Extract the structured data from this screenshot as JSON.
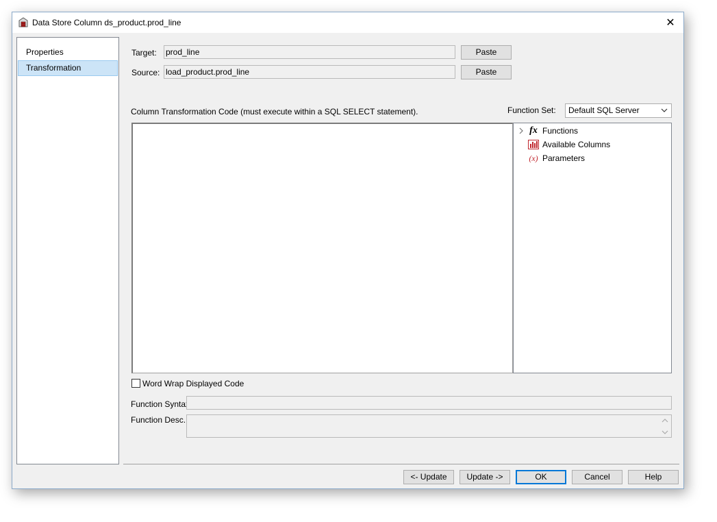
{
  "window": {
    "title": "Data Store Column ds_product.prod_line",
    "close_glyph": "✕"
  },
  "nav": {
    "items": [
      {
        "label": "Properties",
        "selected": false
      },
      {
        "label": "Transformation",
        "selected": true
      }
    ]
  },
  "target": {
    "label": "Target:",
    "value": "prod_line",
    "paste_label": "Paste"
  },
  "source": {
    "label": "Source:",
    "value": "load_product.prod_line",
    "paste_label": "Paste"
  },
  "code": {
    "label": "Column Transformation Code (must execute within a SQL SELECT statement)."
  },
  "function_set": {
    "label": "Function Set:",
    "selected": "Default SQL Server"
  },
  "tree": {
    "items": [
      {
        "label": "Functions",
        "icon": "function-icon",
        "expandable": true
      },
      {
        "label": "Available Columns",
        "icon": "columns-icon",
        "expandable": false
      },
      {
        "label": "Parameters",
        "icon": "parameters-icon",
        "expandable": false
      }
    ],
    "function_glyph": "fx",
    "parameters_glyph": "(x)"
  },
  "wordwrap": {
    "label": "Word Wrap Displayed Code",
    "checked": false
  },
  "function_syntax": {
    "label": "Function Syntax:",
    "value": ""
  },
  "function_desc": {
    "label": "Function Desc.:",
    "value": ""
  },
  "buttons": {
    "update_left": "<- Update",
    "update_right": "Update ->",
    "ok": "OK",
    "cancel": "Cancel",
    "help": "Help"
  },
  "colors": {
    "selection_bg": "#cce4f7",
    "selection_border": "#99c9ef",
    "default_button_border": "#0078d7",
    "icon_red": "#c0262d"
  }
}
